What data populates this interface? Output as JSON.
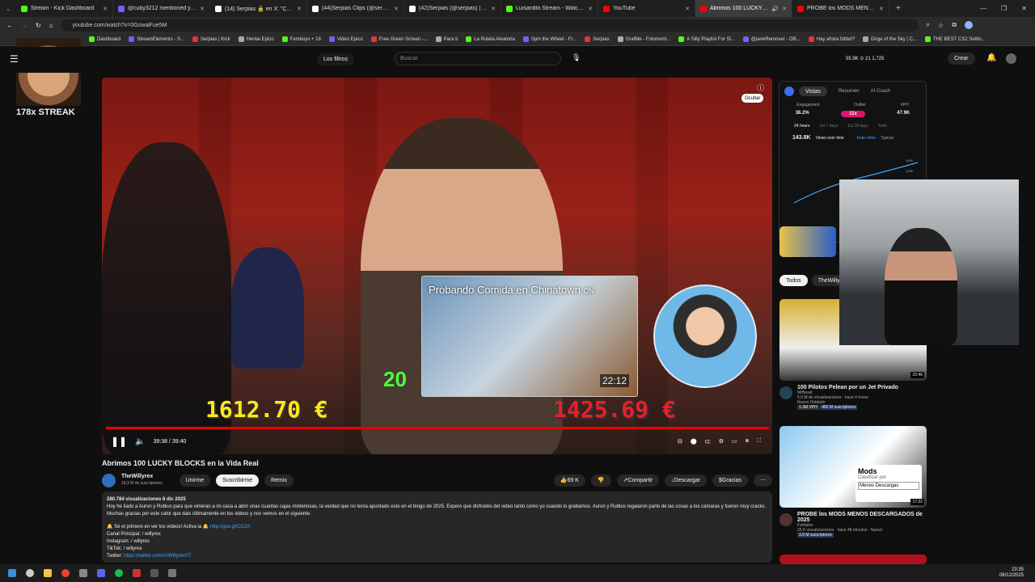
{
  "browser": {
    "tabs": [
      {
        "label": "Stream - Kick Dashboard",
        "color": "#53fc18"
      },
      {
        "label": "@cuby3212 mentioned you",
        "color": "#7a5cff"
      },
      {
        "label": "(14) Serpias 🔒 en X: \"Chicos te",
        "color": "#ffffff"
      },
      {
        "label": "(44)Serpias Clips (@serpias.clip",
        "color": "#ffffff"
      },
      {
        "label": "(42)Serpias (@serpias) | TikTok",
        "color": "#ffffff"
      },
      {
        "label": "Luisardito Stream - Watch Live",
        "color": "#53fc18"
      },
      {
        "label": "YouTube",
        "color": "#ff0000"
      },
      {
        "label": "Abrimos 100 LUCKY BLOC",
        "color": "#ff0000"
      },
      {
        "label": "PROBE los MODS MENOS DE",
        "color": "#ff0000"
      }
    ],
    "url": "youtube.com/watch?v=0GzwaiFue5M",
    "bookmarks": [
      "Dashboard",
      "StreamElements - S...",
      "Serpias | Kick",
      "Hentai Epico",
      "Femboys + 18",
      "Video Epico",
      "Free Green Screen -...",
      "Para ti",
      "La Ruleta Aleatoria",
      "Spin the Wheel - Fr...",
      "Serpias",
      "GrafMe - Fotomont...",
      "A Silly Playlist For Si...",
      "@janeRemover - OB...",
      "Hay ahora fútbol?",
      "Dirge of the Sky | C...",
      "THE BEST CS2 Settin..."
    ]
  },
  "overlay": {
    "streak": "178x STREAK"
  },
  "yt": {
    "filters_label": "Los filtros",
    "search_placeholder": "Buscar",
    "stats": "55.9K  ⊙ 21  1,725",
    "create_label": "Crear",
    "video": {
      "title": "Abrimos 100 LUCKY BLOCKS en la Vida Real",
      "time": "39:38 / 39:40",
      "money_left": "1612.70 €",
      "money_right": "1425.69 €",
      "end_card_title": "Probando Comida en Chinatown",
      "end_card_cn": "CN",
      "end_card_duration": "22:12",
      "hide_label": "Ocultar"
    },
    "channel": {
      "name": "TheWillyrex",
      "subs": "18,3 M de suscriptores",
      "join": "Unirme",
      "subscribe": "Suscribirme",
      "remix": "Remix"
    },
    "actions": {
      "likes": "69 K",
      "share": "Compartir",
      "download": "Descargar",
      "thanks": "Gracias"
    },
    "description": {
      "meta": "280.784 visualizaciones  6 dic 2025",
      "body": "Hoy he liado a Auron y Rubius para que vinieran a mi casa a abrir unas cuantas cajas misteriosas, la verdad que no tenía apuntado esto en el bingo de 2025. Espero que disfrutéis del video tanto como yo cuando lo grabamos. Auron y Rublus regalaron parte de las cosas a los cámaras y fueron muy cracks. Muchas gracias por este calor que dais últimamente en los videos y nos vemos en el siguiente.",
      "line1": "🔔 Sé el primero en ver los videos! Activa la 🔔",
      "link1": "http://goo.gl/Cl12A",
      "line2": "Canal Principal:  / willyrex",
      "line3": "Instagram:  / willyrex",
      "line4": "TikTok:  / willyrex",
      "line5": "Twitter:",
      "link5": "https://twitter.com/#!/WillyrexYT"
    },
    "sidebar": {
      "tabs": [
        "Vistas",
        "Resumen",
        "AI Coach"
      ],
      "metrics_headers": [
        "Engagement",
        "Outlier",
        "VPH"
      ],
      "metrics_values": [
        "36.2%",
        "11x",
        "47.9K"
      ],
      "ranges": [
        "24 hours",
        "1st 7 days",
        "1st 28 days",
        "Todo"
      ],
      "views": "143.8K",
      "views_label": "Views over time",
      "legend_this": "Este video",
      "legend_typical": "Typical",
      "y_labels": [
        "160K",
        "120K"
      ],
      "chips": [
        "Todos",
        "TheWillyrex"
      ]
    },
    "recs": [
      {
        "title": "100 Pilotos Pelean por un Jet Privado",
        "channel": "MrBeast",
        "meta": "5,9 M de visualizaciones · hace 4 horas",
        "badges": "Nuevo  Doblado",
        "vph": "1.3M VPH",
        "subs": "482 M suscriptores",
        "duration": "22:46"
      },
      {
        "title": "PROBE los MODS MENOS DESCARGADOS de 2025",
        "channel": "Farfadox",
        "meta": "25 K visualizaciones · hace 48 minutos · Nuevo",
        "subs": "3.9 M suscriptores",
        "duration": "17:32",
        "thumb_text": "Mods",
        "thumb_sort": "Clasificar por",
        "thumb_select": "Menos Descargas"
      }
    ]
  },
  "clock": {
    "time": "23:35",
    "date": "06/12/2025"
  }
}
